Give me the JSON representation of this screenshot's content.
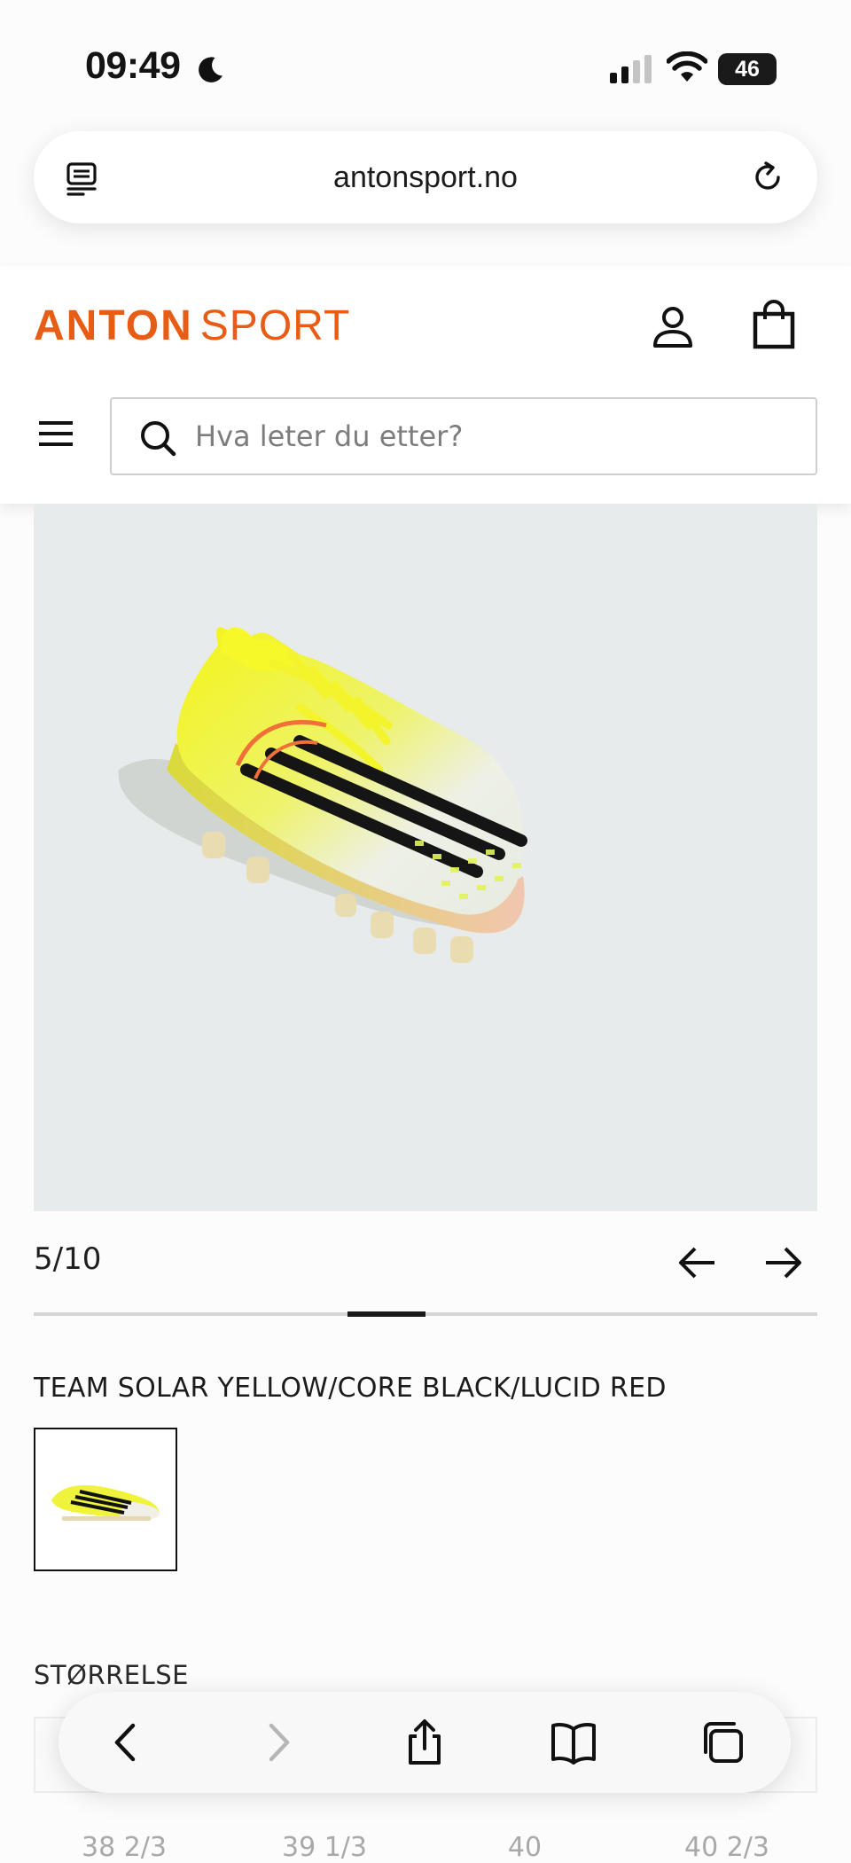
{
  "status_bar": {
    "time": "09:49",
    "battery_level": "46"
  },
  "browser": {
    "url": "antonsport.no"
  },
  "site": {
    "logo_bold": "ANTON",
    "logo_thin": "SPORT",
    "brand_color": "#e85d16",
    "search": {
      "placeholder": "Hva leter du etter?",
      "value": ""
    }
  },
  "gallery": {
    "current": 5,
    "total": 10,
    "counter_text": "5/10"
  },
  "color": {
    "label": "TEAM SOLAR YELLOW/CORE BLACK/LUCID RED"
  },
  "size": {
    "heading": "STØRRELSE",
    "options": [
      "38 2/3",
      "39 1/3",
      "40",
      "40 2/3"
    ]
  }
}
